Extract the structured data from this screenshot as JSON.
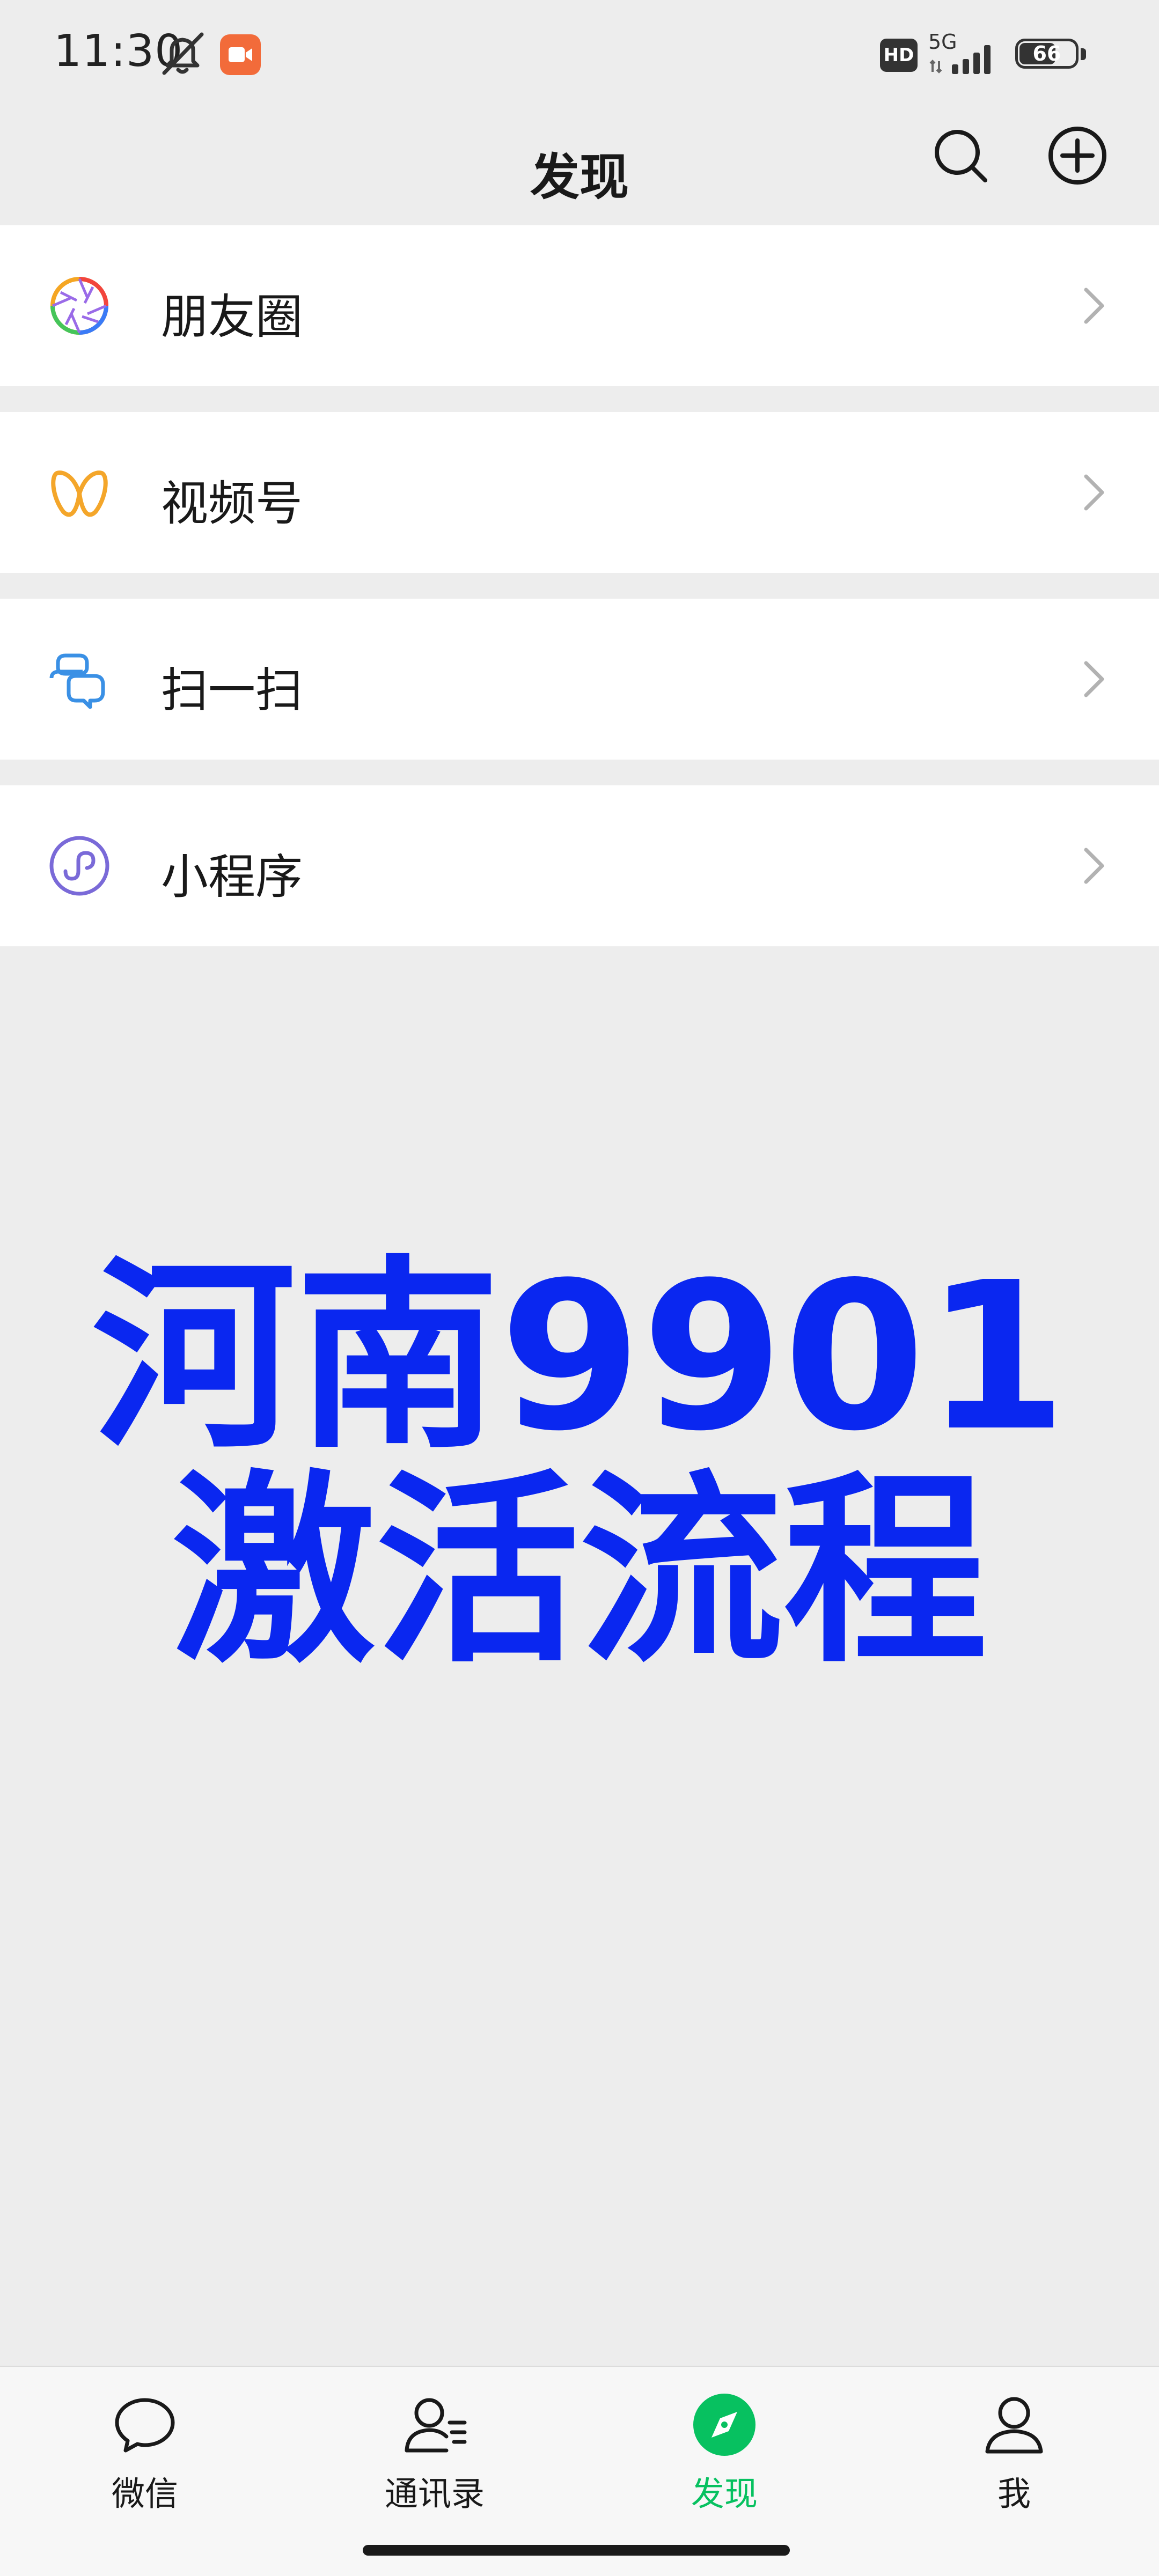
{
  "status_bar": {
    "time": "11:30",
    "hd_label": "HD",
    "network_label": "5G",
    "battery_level": "66",
    "battery_fraction": 0.66,
    "icons": [
      "mute-icon",
      "video-record-icon",
      "hd-icon",
      "signal-icon",
      "battery-icon"
    ]
  },
  "nav": {
    "title": "发现",
    "icons": [
      "search-icon",
      "add-icon"
    ]
  },
  "menu": {
    "items": [
      {
        "label": "朋友圈",
        "icon": "moments-icon"
      },
      {
        "label": "视频号",
        "icon": "channels-icon"
      },
      {
        "label": "扫一扫",
        "icon": "scan-icon"
      },
      {
        "label": "小程序",
        "icon": "mini-program-icon"
      }
    ]
  },
  "promo": {
    "line1": "河南9901",
    "line2": "激活流程",
    "color": "#0a27f0"
  },
  "tabbar": {
    "items": [
      {
        "label": "微信",
        "icon": "chat-icon",
        "active": false
      },
      {
        "label": "通讯录",
        "icon": "contacts-icon",
        "active": false
      },
      {
        "label": "发现",
        "icon": "discover-icon",
        "active": true
      },
      {
        "label": "我",
        "icon": "me-icon",
        "active": false
      }
    ],
    "active_color": "#07c160"
  }
}
